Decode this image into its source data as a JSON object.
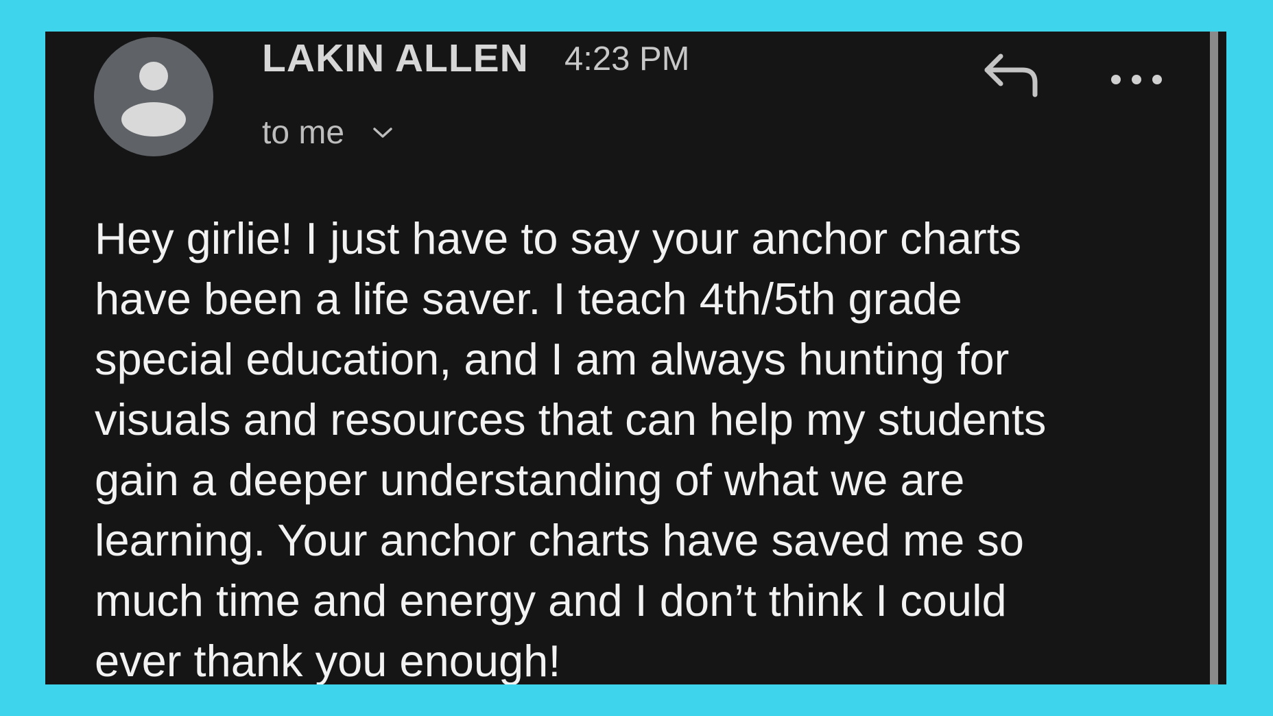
{
  "email": {
    "sender_name": "LAKIN ALLEN",
    "time": "4:23 PM",
    "recipient_label": "to me",
    "body": "Hey girlie! I just have to say your anchor charts\nhave been a life saver. I teach 4th/5th grade\nspecial education, and I am always hunting for\nvisuals and resources that can help my students\ngain a deeper understanding of what we are\nlearning. Your anchor charts have saved me so\nmuch time and energy and I don’t think I could\never thank you enough!"
  },
  "icons": {
    "avatar": "person-avatar-icon",
    "recipient_toggle": "chevron-down-icon",
    "reply": "reply-icon",
    "more": "more-horizontal-icon"
  },
  "colors": {
    "frame_background": "#3dd4ec",
    "card_background": "#151515",
    "avatar_background": "#5f6368",
    "body_text": "#f2f2f2",
    "muted_text": "#bdbdbd"
  }
}
